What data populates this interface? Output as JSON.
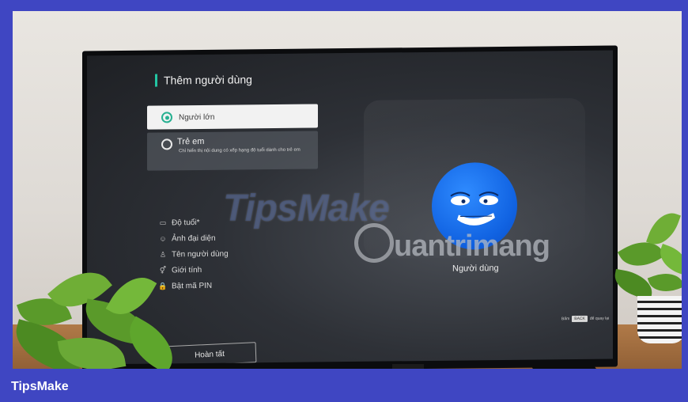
{
  "screen": {
    "title": "Thêm người dùng",
    "options": [
      {
        "label": "Người lớn",
        "selected": true
      },
      {
        "label": "Trẻ em",
        "description": "Chỉ hiển thị nội dung có xếp hạng độ tuổi dành cho trẻ em",
        "selected": false
      }
    ],
    "menu": [
      {
        "icon": "calendar-icon",
        "glyph": "▭",
        "label": "Độ tuổi*"
      },
      {
        "icon": "face-icon",
        "glyph": "☺",
        "label": "Ảnh đại diện"
      },
      {
        "icon": "person-icon",
        "glyph": "♙",
        "label": "Tên người dùng"
      },
      {
        "icon": "gender-icon",
        "glyph": "⚥",
        "label": "Giới tính"
      },
      {
        "icon": "lock-icon",
        "glyph": "🔒",
        "label": "Bật mã PIN"
      }
    ],
    "done_button": "Hoàn tất",
    "avatar_label": "Người dùng",
    "hint": {
      "prefix": "Bấm",
      "key": "BACK",
      "suffix": "để quay lại"
    }
  },
  "watermark": {
    "line1": "TipsMake",
    "line2": "uantrimang"
  },
  "footer": {
    "brand": "TipsMake"
  },
  "colors": {
    "accent": "#23c5a3",
    "avatar": "#1e6ff0",
    "footer": "#3f46c2"
  }
}
